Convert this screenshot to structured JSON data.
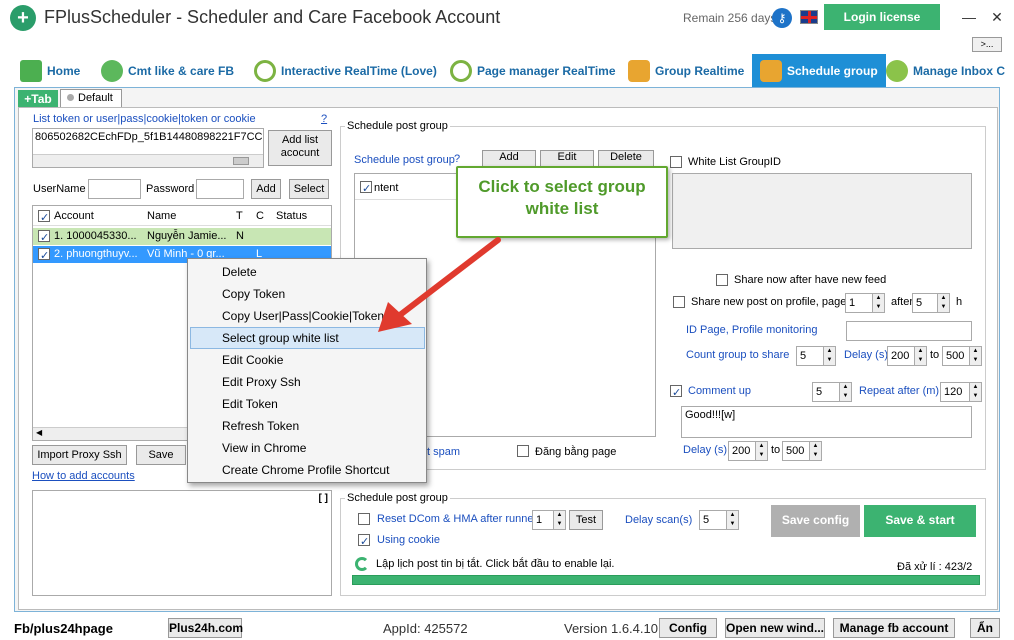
{
  "window": {
    "title": "FPlusScheduler - Scheduler and Care Facebook Account",
    "remain": "Remain 256 days",
    "login_label": "Login license",
    "more_label": ">..."
  },
  "tabs": [
    {
      "label": "Home",
      "icon": "home-icon"
    },
    {
      "label": "Cmt like & care FB",
      "icon": "users-icon"
    },
    {
      "label": "Interactive RealTime (Love)",
      "icon": "clock-icon"
    },
    {
      "label": "Page manager RealTime",
      "icon": "clock-icon"
    },
    {
      "label": "Group Realtime",
      "icon": "group-icon"
    },
    {
      "label": "Schedule group",
      "icon": "group-icon",
      "active": true
    },
    {
      "label": "Manage Inbox C",
      "icon": "chat-icon"
    }
  ],
  "subtabs": {
    "add": "+Tab",
    "default": "Default"
  },
  "left": {
    "token_label": "List token or user|pass|cookie|token or cookie",
    "help": "?",
    "token_value": "806502682CEchFDp_5f1B14480898221F7CC;",
    "add_list_label": "Add list acocunt",
    "username_label": "UserName",
    "password_label": "Password",
    "add_btn": "Add",
    "select_btn": "Select",
    "columns": [
      "Account",
      "Name",
      "T",
      "C",
      "Status"
    ],
    "rows": [
      {
        "account": "1. 1000045330...",
        "name": "Nguyễn Jamie...",
        "t": "N",
        "c": "",
        "status": ""
      },
      {
        "account": "2. phuongthuyv...",
        "name": "Vũ Minh - 0 gr...",
        "t": "",
        "c": "L",
        "status": ""
      }
    ],
    "import_proxy": "Import Proxy Ssh",
    "save": "Save",
    "how_to": "How to add accounts",
    "log_btn": "[ ]"
  },
  "context_menu": {
    "items": [
      "Delete",
      "Copy Token",
      "Copy User|Pass|Cookie|Token",
      "Select group white list",
      "Edit Cookie",
      "Edit Proxy Ssh",
      "Edit Token",
      "Refresh Token",
      "View in Chrome",
      "Create Chrome Profile Shortcut"
    ],
    "highlighted": "Select group white list"
  },
  "callout": "Click to select group white list",
  "schedule": {
    "group_title": "Schedule post group",
    "schedule_label": "Schedule post group",
    "q": "?",
    "add_btn": "Add",
    "edit_btn": "Edit",
    "delete_btn": "Delete",
    "content_col": "ntent",
    "white_list_label": "White List GroupID",
    "share_now": "Share now after have new feed",
    "share_profile": "Share new post on profile, page",
    "share_profile_val": "1",
    "after_label": "after",
    "after_val": "5",
    "h_label": "h",
    "id_page_label": "ID Page, Profile monitoring",
    "count_group_label": "Count group to share",
    "count_group_val": "5",
    "delay_label": "Delay (s)",
    "delay_from": "200",
    "to_label": "to",
    "delay_to": "500",
    "comment_up": "Comment up",
    "comment_val": "5",
    "repeat_label": "Repeat after (m)",
    "repeat_val": "120",
    "comment_text": "Good!!![w]",
    "delay2_label": "Delay (s)",
    "delay2_from": "200",
    "delay2_to": "500",
    "spam_label": "t spam",
    "dang_bang_page": "Đăng bằng page"
  },
  "bottom": {
    "group_title": "Schedule post group",
    "reset_label": "Reset DCom & HMA after runned",
    "reset_val": "1",
    "test_btn": "Test",
    "delay_scan_label": "Delay scan(s)",
    "delay_scan_val": "5",
    "using_cookie": "Using cookie",
    "save_config": "Save config",
    "save_start": "Save & start",
    "status_msg": "Lập lịch post tin bị tắt. Click bắt đầu to enable lại.",
    "processed": "Đã xử lí : 423/2"
  },
  "statusbar": {
    "fb": "Fb/plus24hpage",
    "site": "Plus24h.com",
    "appid": "AppId: 425572",
    "version": "Version 1.6.4.10",
    "config": "Config",
    "open_new": "Open new wind...",
    "manage_fb": "Manage fb account",
    "hide": "Ẩn"
  },
  "colors": {
    "accent": "#1e8fd6",
    "green": "#3cb371",
    "callout": "#62a830",
    "arrow": "#e03a2e"
  }
}
